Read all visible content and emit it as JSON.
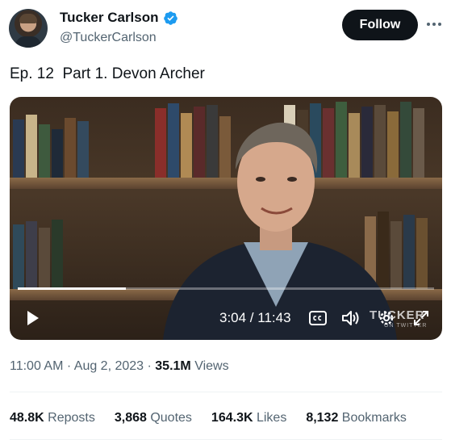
{
  "author": {
    "display_name": "Tucker Carlson",
    "handle": "@TuckerCarlson",
    "verified": true,
    "verified_color": "#1d9bf0"
  },
  "follow_button": {
    "label": "Follow"
  },
  "more_button": {
    "icon": "more-horizontal-icon"
  },
  "tweet": {
    "text": "Ep. 12  Part 1. Devon Archer"
  },
  "video": {
    "current_time": "3:04",
    "duration": "11:43",
    "time_display": "3:04 / 11:43",
    "progress": 0.26,
    "watermark": "TUCKER",
    "watermark_sub": "ON TWITTER",
    "controls": [
      "play-icon",
      "closed-captions-icon",
      "volume-icon",
      "settings-icon",
      "fullscreen-icon"
    ]
  },
  "meta": {
    "time": "11:00 AM",
    "separator": " · ",
    "date": "Aug 2, 2023",
    "views_count": "35.1M",
    "views_label": " Views"
  },
  "stats": [
    {
      "value": "48.8K",
      "label": " Reposts"
    },
    {
      "value": "3,868",
      "label": " Quotes"
    },
    {
      "value": "164.3K",
      "label": " Likes"
    },
    {
      "value": "8,132",
      "label": " Bookmarks"
    }
  ],
  "colors": {
    "text_primary": "#0f1419",
    "text_secondary": "#536471",
    "follow_bg": "#0f1419",
    "divider": "#eff3f4"
  }
}
